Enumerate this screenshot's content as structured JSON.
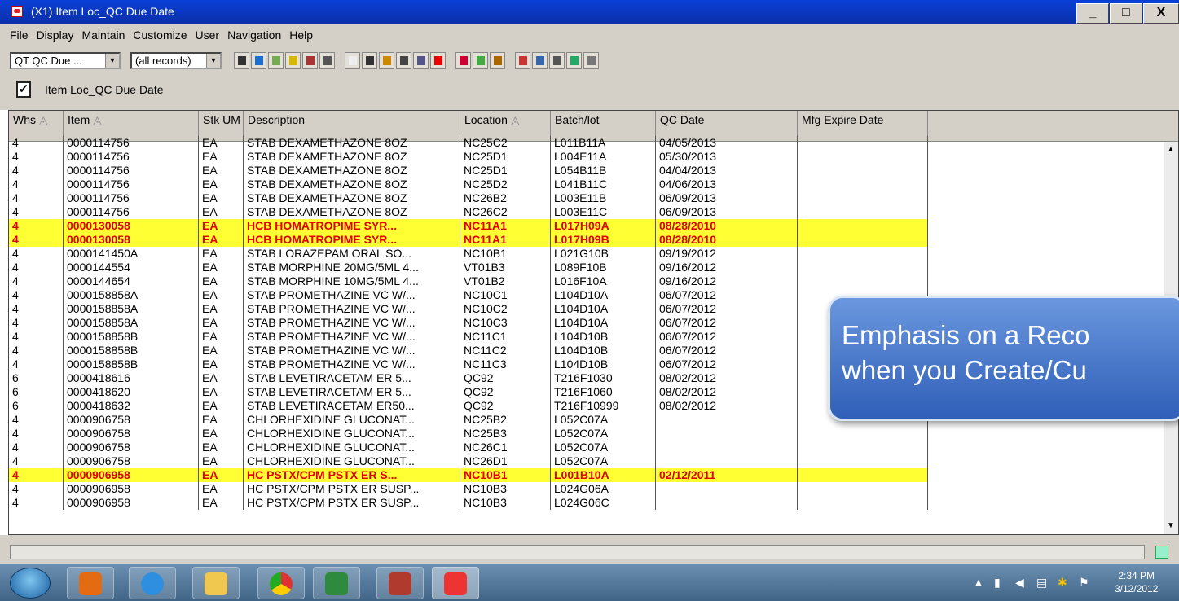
{
  "window": {
    "title": "(X1) Item Loc_QC Due Date",
    "min": "_",
    "max": "□",
    "close": "X"
  },
  "menu": [
    "File",
    "Display",
    "Maintain",
    "Customize",
    "User",
    "Navigation",
    "Help"
  ],
  "toolbar": {
    "view_select": "QT QC Due ...",
    "filter_select": "(all records)"
  },
  "subheader": {
    "checkmark": "✓",
    "label": "Item Loc_QC Due Date"
  },
  "columns": [
    {
      "label": "Whs",
      "sort": "◬"
    },
    {
      "label": "Item",
      "sort": "◬"
    },
    {
      "label": "Stk UM",
      "sort": ""
    },
    {
      "label": "Description",
      "sort": ""
    },
    {
      "label": "Location",
      "sort": "◬"
    },
    {
      "label": "Batch/lot",
      "sort": ""
    },
    {
      "label": "QC Date",
      "sort": ""
    },
    {
      "label": "Mfg Expire Date",
      "sort": ""
    }
  ],
  "rows": [
    {
      "whs": "4",
      "item": "0000114756",
      "um": "EA",
      "desc": "STAB DEXAMETHAZONE 8OZ",
      "loc": "NC25C2",
      "lot": "L011B11A",
      "qc": "04/05/2013",
      "mfg": "",
      "hl": false
    },
    {
      "whs": "4",
      "item": "0000114756",
      "um": "EA",
      "desc": "STAB DEXAMETHAZONE 8OZ",
      "loc": "NC25D1",
      "lot": "L004E11A",
      "qc": "05/30/2013",
      "mfg": "",
      "hl": false
    },
    {
      "whs": "4",
      "item": "0000114756",
      "um": "EA",
      "desc": "STAB DEXAMETHAZONE 8OZ",
      "loc": "NC25D1",
      "lot": "L054B11B",
      "qc": "04/04/2013",
      "mfg": "",
      "hl": false
    },
    {
      "whs": "4",
      "item": "0000114756",
      "um": "EA",
      "desc": "STAB DEXAMETHAZONE 8OZ",
      "loc": "NC25D2",
      "lot": "L041B11C",
      "qc": "04/06/2013",
      "mfg": "",
      "hl": false
    },
    {
      "whs": "4",
      "item": "0000114756",
      "um": "EA",
      "desc": "STAB DEXAMETHAZONE 8OZ",
      "loc": "NC26B2",
      "lot": "L003E11B",
      "qc": "06/09/2013",
      "mfg": "",
      "hl": false
    },
    {
      "whs": "4",
      "item": "0000114756",
      "um": "EA",
      "desc": "STAB DEXAMETHAZONE 8OZ",
      "loc": "NC26C2",
      "lot": "L003E11C",
      "qc": "06/09/2013",
      "mfg": "",
      "hl": false
    },
    {
      "whs": "4",
      "item": "0000130058",
      "um": "EA",
      "desc": "HCB HOMATROPIME SYR...",
      "loc": "NC11A1",
      "lot": "L017H09A",
      "qc": "08/28/2010",
      "mfg": "",
      "hl": true
    },
    {
      "whs": "4",
      "item": "0000130058",
      "um": "EA",
      "desc": "HCB HOMATROPIME SYR...",
      "loc": "NC11A1",
      "lot": "L017H09B",
      "qc": "08/28/2010",
      "mfg": "",
      "hl": true
    },
    {
      "whs": "4",
      "item": "0000141450A",
      "um": "EA",
      "desc": "STAB LORAZEPAM ORAL SO...",
      "loc": "NC10B1",
      "lot": "L021G10B",
      "qc": "09/19/2012",
      "mfg": "",
      "hl": false
    },
    {
      "whs": "4",
      "item": "0000144554",
      "um": "EA",
      "desc": "STAB MORPHINE 20MG/5ML 4...",
      "loc": "VT01B3",
      "lot": "L089F10B",
      "qc": "09/16/2012",
      "mfg": "",
      "hl": false
    },
    {
      "whs": "4",
      "item": "0000144654",
      "um": "EA",
      "desc": "STAB MORPHINE 10MG/5ML 4...",
      "loc": "VT01B2",
      "lot": "L016F10A",
      "qc": "09/16/2012",
      "mfg": "",
      "hl": false
    },
    {
      "whs": "4",
      "item": "0000158858A",
      "um": "EA",
      "desc": "STAB PROMETHAZINE VC W/...",
      "loc": "NC10C1",
      "lot": "L104D10A",
      "qc": "06/07/2012",
      "mfg": "",
      "hl": false
    },
    {
      "whs": "4",
      "item": "0000158858A",
      "um": "EA",
      "desc": "STAB PROMETHAZINE VC W/...",
      "loc": "NC10C2",
      "lot": "L104D10A",
      "qc": "06/07/2012",
      "mfg": "",
      "hl": false
    },
    {
      "whs": "4",
      "item": "0000158858A",
      "um": "EA",
      "desc": "STAB PROMETHAZINE VC W/...",
      "loc": "NC10C3",
      "lot": "L104D10A",
      "qc": "06/07/2012",
      "mfg": "",
      "hl": false
    },
    {
      "whs": "4",
      "item": "0000158858B",
      "um": "EA",
      "desc": "STAB PROMETHAZINE VC W/...",
      "loc": "NC11C1",
      "lot": "L104D10B",
      "qc": "06/07/2012",
      "mfg": "",
      "hl": false
    },
    {
      "whs": "4",
      "item": "0000158858B",
      "um": "EA",
      "desc": "STAB PROMETHAZINE VC W/...",
      "loc": "NC11C2",
      "lot": "L104D10B",
      "qc": "06/07/2012",
      "mfg": "",
      "hl": false
    },
    {
      "whs": "4",
      "item": "0000158858B",
      "um": "EA",
      "desc": "STAB PROMETHAZINE VC W/...",
      "loc": "NC11C3",
      "lot": "L104D10B",
      "qc": "06/07/2012",
      "mfg": "",
      "hl": false
    },
    {
      "whs": "6",
      "item": "0000418616",
      "um": "EA",
      "desc": "STAB LEVETIRACETAM ER 5...",
      "loc": "QC92",
      "lot": "T216F1030",
      "qc": "08/02/2012",
      "mfg": "",
      "hl": false
    },
    {
      "whs": "6",
      "item": "0000418620",
      "um": "EA",
      "desc": "STAB LEVETIRACETAM ER 5...",
      "loc": "QC92",
      "lot": "T216F1060",
      "qc": "08/02/2012",
      "mfg": "",
      "hl": false
    },
    {
      "whs": "6",
      "item": "0000418632",
      "um": "EA",
      "desc": "STAB LEVETIRACETAM ER50...",
      "loc": "QC92",
      "lot": "T216F10999",
      "qc": "08/02/2012",
      "mfg": "",
      "hl": false
    },
    {
      "whs": "4",
      "item": "0000906758",
      "um": "EA",
      "desc": "CHLORHEXIDINE GLUCONAT...",
      "loc": "NC25B2",
      "lot": "L052C07A",
      "qc": "",
      "mfg": "",
      "hl": false
    },
    {
      "whs": "4",
      "item": "0000906758",
      "um": "EA",
      "desc": "CHLORHEXIDINE GLUCONAT...",
      "loc": "NC25B3",
      "lot": "L052C07A",
      "qc": "",
      "mfg": "",
      "hl": false
    },
    {
      "whs": "4",
      "item": "0000906758",
      "um": "EA",
      "desc": "CHLORHEXIDINE GLUCONAT...",
      "loc": "NC26C1",
      "lot": "L052C07A",
      "qc": "",
      "mfg": "",
      "hl": false
    },
    {
      "whs": "4",
      "item": "0000906758",
      "um": "EA",
      "desc": "CHLORHEXIDINE GLUCONAT...",
      "loc": "NC26D1",
      "lot": "L052C07A",
      "qc": "",
      "mfg": "",
      "hl": false
    },
    {
      "whs": "4",
      "item": "0000906958",
      "um": "EA",
      "desc": "HC PSTX/CPM PSTX ER S...",
      "loc": "NC10B1",
      "lot": "L001B10A",
      "qc": "02/12/2011",
      "mfg": "",
      "hl": true
    },
    {
      "whs": "4",
      "item": "0000906958",
      "um": "EA",
      "desc": "HC PSTX/CPM PSTX ER SUSP...",
      "loc": "NC10B3",
      "lot": "L024G06A",
      "qc": "",
      "mfg": "",
      "hl": false
    },
    {
      "whs": "4",
      "item": "0000906958",
      "um": "EA",
      "desc": "HC PSTX/CPM PSTX ER SUSP...",
      "loc": "NC10B3",
      "lot": "L024G06C",
      "qc": "",
      "mfg": "",
      "hl": false
    }
  ],
  "callout": {
    "line1": "Emphasis on a Reco",
    "line2": "when you Create/Cu"
  },
  "taskbar": {
    "time": "2:34 PM",
    "date": "3/12/2012"
  },
  "colors": {
    "highlight_bg": "#ffff33",
    "highlight_text": "#e00000",
    "titlebar": "#0a3fd6"
  }
}
